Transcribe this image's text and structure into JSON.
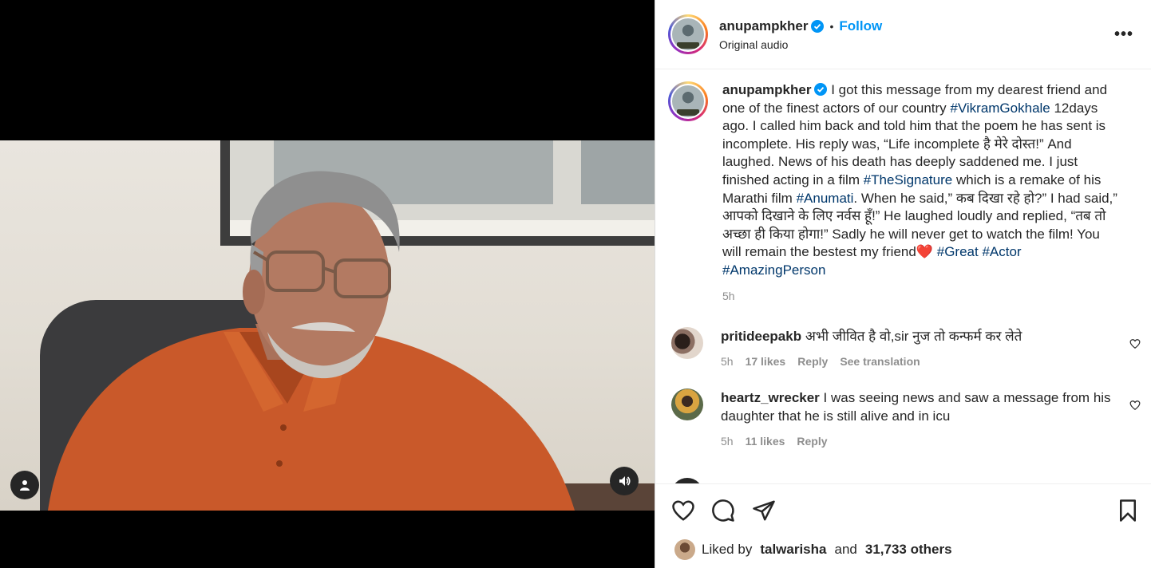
{
  "post": {
    "author": "anupampkher",
    "follow_label": "Follow",
    "separator": "•",
    "audio": "Original audio",
    "more_label": "•••"
  },
  "caption": {
    "author": "anupampkher",
    "parts": [
      {
        "text": " I got this message from my dearest friend and one of the finest actors of our country ",
        "tag": false
      },
      {
        "text": "#VikramGokhale",
        "tag": true
      },
      {
        "text": " 12days ago. I called him back and told him that the poem he has sent is incomplete. His reply was, “Life incomplete है मेरे दोस्त!” And laughed. News of his death has deeply saddened me. I just finished acting in a film ",
        "tag": false
      },
      {
        "text": "#TheSignature",
        "tag": true
      },
      {
        "text": " which is a remake of his Marathi film ",
        "tag": false
      },
      {
        "text": "#Anumati",
        "tag": true
      },
      {
        "text": ". When he said,” कब दिखा रहे हो?” I had said,” आपको दिखाने के लिए नर्वस हूँ!” He laughed loudly and replied, “तब तो अच्छा ही किया होगा!” Sadly he will never get to watch the film! You will remain the bestest my friend",
        "tag": false
      },
      {
        "text": "❤️",
        "tag": false
      },
      {
        "text": " ",
        "tag": false
      },
      {
        "text": "#Great",
        "tag": true
      },
      {
        "text": " ",
        "tag": false
      },
      {
        "text": "#Actor",
        "tag": true
      },
      {
        "text": " ",
        "tag": false
      },
      {
        "text": "#AmazingPerson",
        "tag": true
      }
    ],
    "time": "5h"
  },
  "comments": [
    {
      "user": "pritideepakb",
      "text": "अभी जीवित है वो,sir नुज तो कन्फर्म कर लेते",
      "time": "5h",
      "likes": "17 likes",
      "reply": "Reply",
      "translate": "See translation"
    },
    {
      "user": "heartz_wrecker",
      "text": "I was seeing news and saw a message from his daughter that he is still alive and in icu",
      "time": "5h",
      "likes": "11 likes",
      "reply": "Reply",
      "translate": ""
    }
  ],
  "likes_line": {
    "prefix": "Liked by",
    "user": "talwarisha",
    "and": "and",
    "others": "31,733 others"
  },
  "colors": {
    "link_blue": "#0095f6",
    "hashtag": "#00376b",
    "muted": "#8e8e8e"
  },
  "icons": [
    "verified-icon",
    "more-icon",
    "heart-icon",
    "comment-icon",
    "share-icon",
    "bookmark-icon",
    "user-tag-icon",
    "volume-icon"
  ]
}
